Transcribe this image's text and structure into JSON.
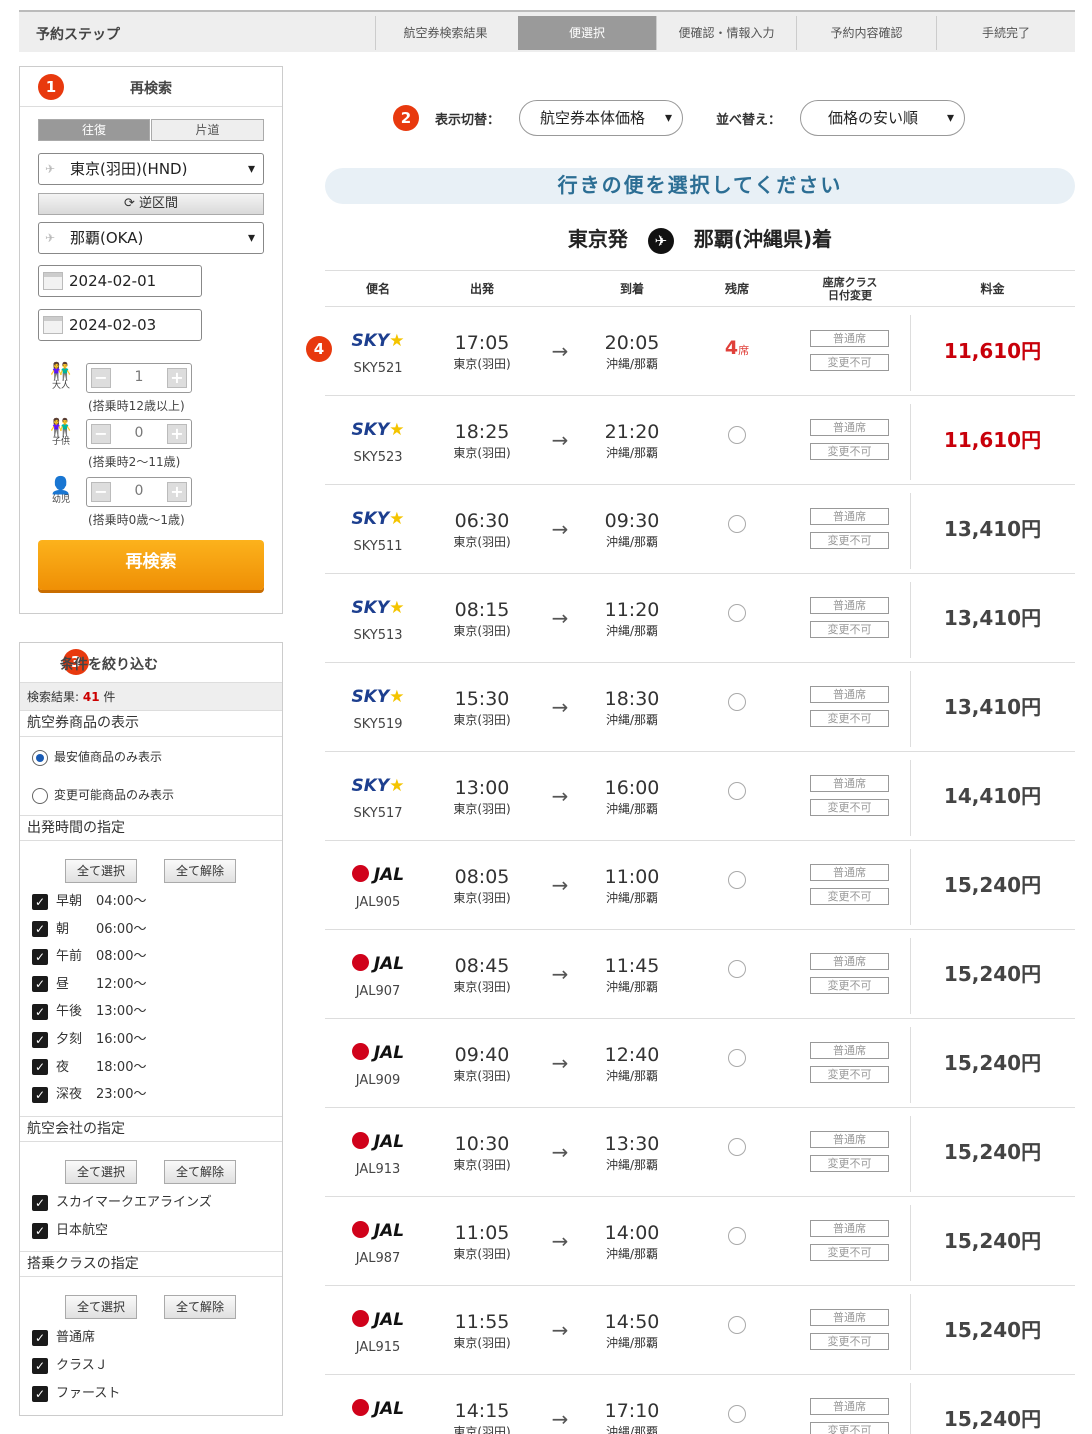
{
  "steps": {
    "title": "予約ステップ",
    "items": [
      "航空券検索結果",
      "便選択",
      "便確認・情報入力",
      "予約内容確認",
      "手続完了"
    ],
    "active": 1
  },
  "research": {
    "badge": "1",
    "title": "再検索",
    "trip_round": "往復",
    "trip_oneway": "片道",
    "from": "東京(羽田)(HND)",
    "swap_label": "逆区間",
    "to": "那覇(OKA)",
    "depart_date": "2024-02-01",
    "return_date": "2024-02-03",
    "pax": [
      {
        "label": "大人",
        "value": "1",
        "note": "(搭乗時12歳以上)"
      },
      {
        "label": "子供",
        "value": "0",
        "note": "(搭乗時2〜11歳)"
      },
      {
        "label": "幼児",
        "value": "0",
        "note": "(搭乗時0歳〜1歳)"
      }
    ],
    "minus": "−",
    "plus": "+",
    "search_button": "再検索"
  },
  "filter": {
    "badge": "3",
    "title": "条件を絞り込む",
    "result_label": "検索結果:",
    "result_count": "41",
    "result_unit": "件",
    "product_heading": "航空券商品の表示",
    "product_options": [
      "最安値商品のみ表示",
      "変更可能商品のみ表示"
    ],
    "time_heading": "出発時間の指定",
    "select_all": "全て選択",
    "clear_all": "全て解除",
    "times": [
      {
        "name": "早朝",
        "time": "04:00〜"
      },
      {
        "name": "朝",
        "time": "06:00〜"
      },
      {
        "name": "午前",
        "time": "08:00〜"
      },
      {
        "name": "昼",
        "time": "12:00〜"
      },
      {
        "name": "午後",
        "time": "13:00〜"
      },
      {
        "name": "夕刻",
        "time": "16:00〜"
      },
      {
        "name": "夜",
        "time": "18:00〜"
      },
      {
        "name": "深夜",
        "time": "23:00〜"
      }
    ],
    "airline_heading": "航空会社の指定",
    "airlines": [
      "スカイマークエアラインズ",
      "日本航空"
    ],
    "class_heading": "搭乗クラスの指定",
    "classes": [
      "普通席",
      "クラスＪ",
      "ファースト"
    ],
    "check_mark": "✓"
  },
  "sort": {
    "badge": "2",
    "display_label": "表示切替：",
    "display_value": "航空券本体価格",
    "order_label": "並べ替え：",
    "order_value": "価格の安い順",
    "chevron": "⌄"
  },
  "banner": "行きの便を選択してください",
  "route": {
    "from": "東京発",
    "to": "那覇(沖縄県)着",
    "plane": "✈"
  },
  "table": {
    "headers": {
      "flight": "便名",
      "depart": "出発",
      "arrive": "到着",
      "seats": "残席",
      "class_line1": "座席クラス",
      "class_line2": "日付変更",
      "price": "料金"
    },
    "row_badge": "4",
    "arrow": "→",
    "seat_unit": "席",
    "class_label": "普通席",
    "change_label": "変更不可",
    "rows": [
      {
        "airline": "SKY",
        "flight": "SKY521",
        "dep": "17:05",
        "dep_ap": "東京(羽田)",
        "arr": "20:05",
        "arr_ap": "沖縄/那覇",
        "seats": "4",
        "price": "11,610円"
      },
      {
        "airline": "SKY",
        "flight": "SKY523",
        "dep": "18:25",
        "dep_ap": "東京(羽田)",
        "arr": "21:20",
        "arr_ap": "沖縄/那覇",
        "seats": "",
        "price": "11,610円"
      },
      {
        "airline": "SKY",
        "flight": "SKY511",
        "dep": "06:30",
        "dep_ap": "東京(羽田)",
        "arr": "09:30",
        "arr_ap": "沖縄/那覇",
        "seats": "",
        "price": "13,410円"
      },
      {
        "airline": "SKY",
        "flight": "SKY513",
        "dep": "08:15",
        "dep_ap": "東京(羽田)",
        "arr": "11:20",
        "arr_ap": "沖縄/那覇",
        "seats": "",
        "price": "13,410円"
      },
      {
        "airline": "SKY",
        "flight": "SKY519",
        "dep": "15:30",
        "dep_ap": "東京(羽田)",
        "arr": "18:30",
        "arr_ap": "沖縄/那覇",
        "seats": "",
        "price": "13,410円"
      },
      {
        "airline": "SKY",
        "flight": "SKY517",
        "dep": "13:00",
        "dep_ap": "東京(羽田)",
        "arr": "16:00",
        "arr_ap": "沖縄/那覇",
        "seats": "",
        "price": "14,410円"
      },
      {
        "airline": "JAL",
        "flight": "JAL905",
        "dep": "08:05",
        "dep_ap": "東京(羽田)",
        "arr": "11:00",
        "arr_ap": "沖縄/那覇",
        "seats": "",
        "price": "15,240円"
      },
      {
        "airline": "JAL",
        "flight": "JAL907",
        "dep": "08:45",
        "dep_ap": "東京(羽田)",
        "arr": "11:45",
        "arr_ap": "沖縄/那覇",
        "seats": "",
        "price": "15,240円"
      },
      {
        "airline": "JAL",
        "flight": "JAL909",
        "dep": "09:40",
        "dep_ap": "東京(羽田)",
        "arr": "12:40",
        "arr_ap": "沖縄/那覇",
        "seats": "",
        "price": "15,240円"
      },
      {
        "airline": "JAL",
        "flight": "JAL913",
        "dep": "10:30",
        "dep_ap": "東京(羽田)",
        "arr": "13:30",
        "arr_ap": "沖縄/那覇",
        "seats": "",
        "price": "15,240円"
      },
      {
        "airline": "JAL",
        "flight": "JAL987",
        "dep": "11:05",
        "dep_ap": "東京(羽田)",
        "arr": "14:00",
        "arr_ap": "沖縄/那覇",
        "seats": "",
        "price": "15,240円"
      },
      {
        "airline": "JAL",
        "flight": "JAL915",
        "dep": "11:55",
        "dep_ap": "東京(羽田)",
        "arr": "14:50",
        "arr_ap": "沖縄/那覇",
        "seats": "",
        "price": "15,240円"
      },
      {
        "airline": "JAL",
        "flight": "",
        "dep": "14:15",
        "dep_ap": "東京(羽田)",
        "arr": "17:10",
        "arr_ap": "沖縄/那覇",
        "seats": "",
        "price": "15,240円"
      }
    ]
  }
}
